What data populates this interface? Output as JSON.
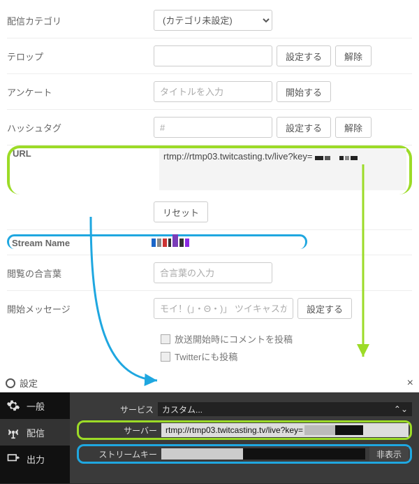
{
  "form": {
    "category": {
      "label": "配信カテゴリ",
      "select_value": "(カテゴリ未設定)"
    },
    "telop": {
      "label": "テロップ",
      "btn_set": "設定する",
      "btn_clear": "解除"
    },
    "enquete": {
      "label": "アンケート",
      "placeholder": "タイトルを入力",
      "btn_start": "開始する"
    },
    "hashtag": {
      "label": "ハッシュタグ",
      "placeholder": "#",
      "btn_set": "設定する",
      "btn_clear": "解除"
    },
    "url": {
      "label": "URL",
      "value": "rtmp://rtmp03.twitcasting.tv/live?key="
    },
    "reset": {
      "btn": "リセット"
    },
    "stream": {
      "label": "Stream Name"
    },
    "password": {
      "label": "閲覧の合言葉",
      "placeholder": "合言葉の入力"
    },
    "start_message": {
      "label": "開始メッセージ",
      "placeholder": "モイ！(」・Θ・)」 ツイキャスか",
      "btn_set": "設定する"
    },
    "chk_comment": "放送開始時にコメントを投稿",
    "chk_twitter": "Twitterにも投稿"
  },
  "obs": {
    "header": {
      "icon_name": "obs-logo-icon",
      "title": "設定",
      "close": "×"
    },
    "side": [
      {
        "icon": "gear",
        "label": "一般"
      },
      {
        "icon": "antenna",
        "label": "配信"
      },
      {
        "icon": "monitor",
        "label": "出力"
      }
    ],
    "main": {
      "service": {
        "label": "サービス",
        "value": "カスタム..."
      },
      "server": {
        "label": "サーバー",
        "value": "rtmp://rtmp03.twitcasting.tv/live?key="
      },
      "streamkey": {
        "label": "ストリームキー",
        "btn_hide": "非表示"
      }
    }
  },
  "colors": {
    "hl_green": "#9cdb27",
    "hl_blue": "#1fa7e0"
  }
}
